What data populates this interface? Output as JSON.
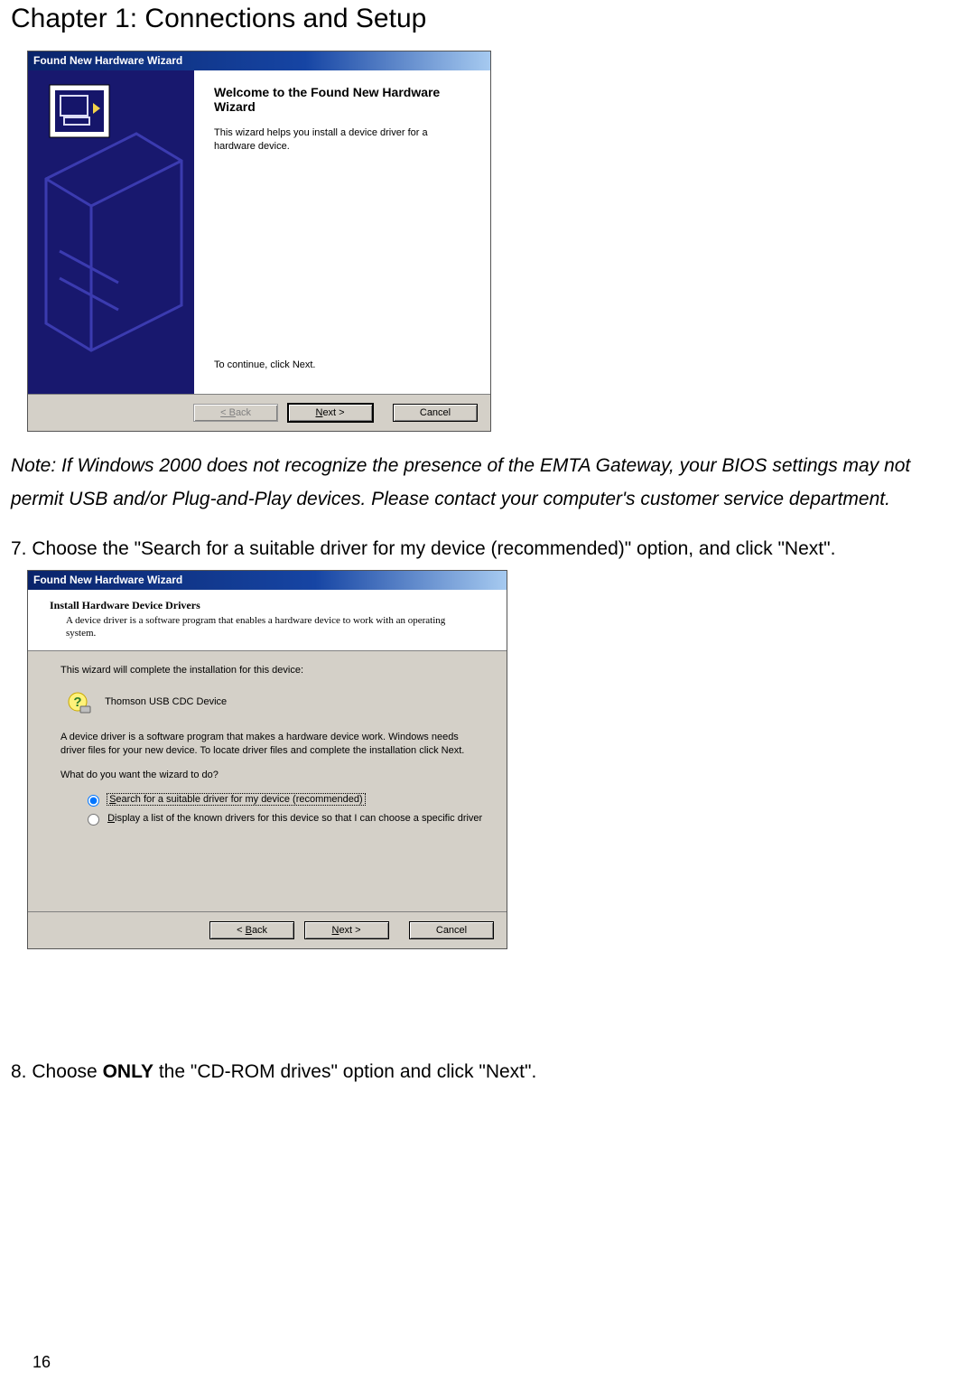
{
  "chapter_title": "Chapter 1: Connections and Setup",
  "note_text": "Note: If Windows 2000 does not recognize the presence of the EMTA Gateway, your BIOS settings may not permit USB and/or Plug-and-Play devices. Please contact your computer's customer service department.",
  "step7": "7. Choose the \"Search for a suitable driver for my device (recommended)\" option, and click \"Next\".",
  "step8_pre": "8. Choose ",
  "step8_bold": "ONLY",
  "step8_post": " the \"CD-ROM drives\" option and click \"Next\".",
  "page_number": "16",
  "wizard1": {
    "title": "Found New Hardware Wizard",
    "heading": "Welcome to the Found New Hardware Wizard",
    "body": "This wizard helps you install a device driver for a hardware device.",
    "continue": "To continue, click Next.",
    "back": "< Back",
    "next": "Next >",
    "cancel": "Cancel"
  },
  "wizard2": {
    "title": "Found New Hardware Wizard",
    "header_title": "Install Hardware Device Drivers",
    "header_sub": "A device driver is a software program that enables a hardware device to work with an operating system.",
    "intro": "This wizard will complete the installation for this device:",
    "device": "Thomson USB CDC Device",
    "explain": "A device driver is a software program that makes a hardware device work. Windows needs driver files for your new device. To locate driver files and complete the installation click Next.",
    "prompt": "What do you want the wizard to do?",
    "opt1": "Search for a suitable driver for my device (recommended)",
    "opt2": "Display a list of the known drivers for this device so that I can choose a specific driver",
    "back": "< Back",
    "next": "Next >",
    "cancel": "Cancel"
  }
}
